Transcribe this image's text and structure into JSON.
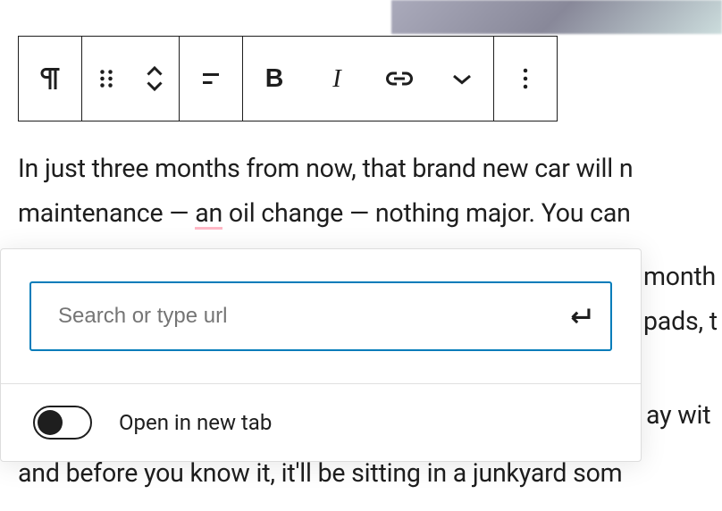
{
  "toolbar": {
    "paragraph_tool": "paragraph",
    "drag_tool": "drag",
    "move_tool": "move",
    "align_tool": "align",
    "bold_tool": "B",
    "italic_tool": "I",
    "link_tool": "link",
    "dropdown_tool": "more-dropdown",
    "more_tool": "options"
  },
  "content": {
    "line1": "In just three months from now, that brand new car will n",
    "line2_before": "maintenance — ",
    "line2_spell": "an",
    "line2_after": " oil change — nothing major. You can",
    "side_month": "month",
    "side_pads": "pads, t",
    "side_ay": "ay wit",
    "lower_line": "and before you know it, it'll be sitting in a junkyard som"
  },
  "link_popover": {
    "url_placeholder": "Search or type url",
    "url_value": "",
    "toggle_label": "Open in new tab"
  }
}
